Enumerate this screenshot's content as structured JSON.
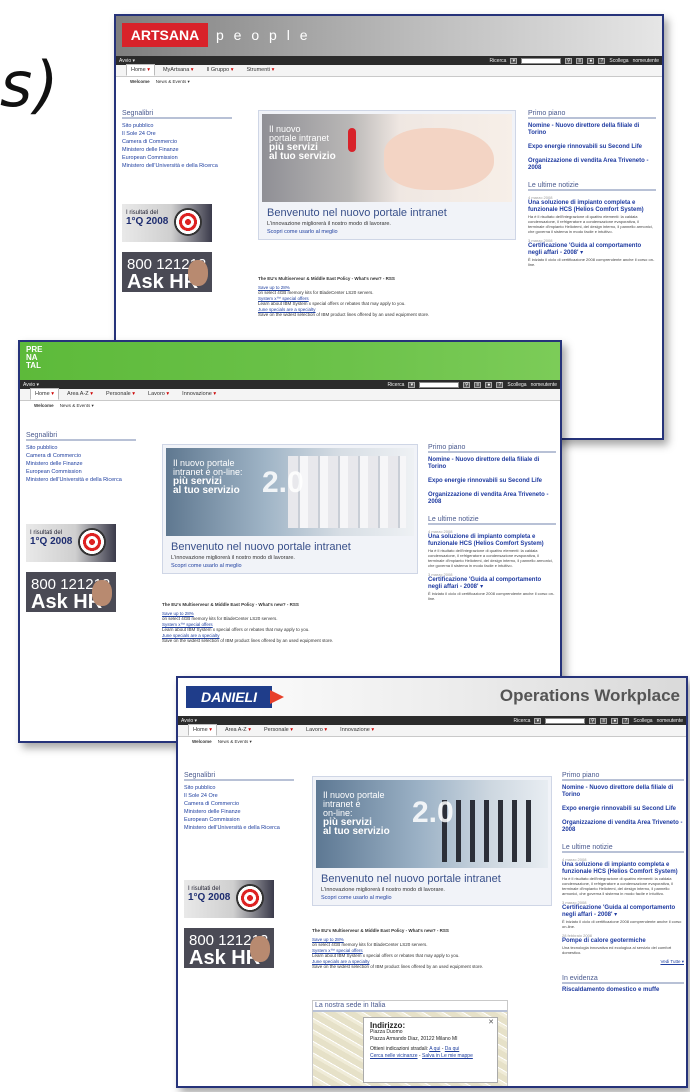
{
  "overlay_text": "s)",
  "common": {
    "nav_left": "Avvio ▾",
    "search_label": "Ricerca",
    "search_placeholder": "Cerca in Angolo",
    "help": "?",
    "logout": "Scollega",
    "user": "nomeutente",
    "subtabs": [
      "Welcome",
      "News & Events ▾"
    ],
    "left_title": "Segnalibri",
    "bookmarks": [
      "Sito pubblico",
      "Il Sole 24 Ore",
      "Camera di Commercio",
      "Ministero delle Finanze",
      "European Commission",
      "Ministero dell'Università e della Ricerca"
    ],
    "banner_results": "I risultati del",
    "banner_q": "1°Q 2008",
    "banner_phone": "800 121212",
    "banner_ask": "Ask HR",
    "hero_title": "Benvenuto nel nuovo portale intranet",
    "hero_sub": "L'innovazione migliorerà il nostro modo di lavorare.",
    "hero_link": "Scopri come usarlo al meglio",
    "feed_title": "The EU's Multiserveur & Middle East Policy - What's new? - RSS",
    "feed_lines": [
      "Save up to 28%",
      "on select 4GB memory kits for BladeCenter LS20 servers.",
      "System x™ special offers",
      "Learn about IBM System x special offers or rebates that may apply to you.",
      "June specials are a specialty",
      "Save on the widest selection of IBM product lines offered by an used equipment store."
    ],
    "right_title1": "Primo piano",
    "primo_piano": [
      "Nomine - Nuovo direttore della filiale di Torino",
      "Expo energie rinnovabili su Second Life",
      "Organizzazione di vendita Area Triveneto - 2008"
    ],
    "right_title2": "Le ultime notizie",
    "news": [
      {
        "date": "4 marzo 2008",
        "title": "Una soluzione di impianto completa e funzionale HCS (Helios Comfort System)",
        "body": "Ha è il risultato dell'integrazione di quattro elementi: la caldaia condensazione, il refrigeratore a condensazione evaporativa, il terminale d'impianto Heliotemi, del design interno, il pannello armonici, che governa il sistema in modo facile e intuitivo."
      },
      {
        "date": "3 marzo 2008",
        "title": "Certificazione 'Guida al comportamento negli affari - 2008' ▾",
        "body": "È iniziato il ciclo di certificazione 2008 comprendente anche il corso on-line."
      },
      {
        "date": "28 febbraio 2008",
        "title": "Pompe di calore geotermiche",
        "body": "Una tecnologia innovativa ed ecologica al servizio del comfort domestico."
      }
    ],
    "more": "Vedi Tutte ▾",
    "right_title3": "In evidenza",
    "evidence": "Riscaldamento domestico e muffe"
  },
  "screens": [
    {
      "brand": "ARTSANA",
      "brand_suffix": "p e o p l e",
      "tabs": [
        "Home",
        "MyArtsana",
        "Il Gruppo",
        "Strumenti"
      ],
      "hero_text": [
        "Il nuovo",
        "portale intranet"
      ],
      "hero_bold": [
        "più servizi",
        "al tuo servizio"
      ]
    },
    {
      "brand": "PRE NA TAL",
      "tabs": [
        "Home",
        "Area A-Z",
        "Personale",
        "Lavoro",
        "Innovazione"
      ],
      "hero_text": [
        "Il nuovo portale",
        "intranet è on-line:"
      ],
      "hero_bold": [
        "più servizi",
        "al tuo servizio"
      ],
      "badge": "2.0"
    },
    {
      "brand": "DANIELI",
      "brand_right": "Operations Workplace",
      "tabs": [
        "Home",
        "Area A-Z",
        "Personale",
        "Lavoro",
        "Innovazione"
      ],
      "hero_text": [
        "Il nuovo portale",
        "intranet è",
        "on-line:"
      ],
      "hero_bold": [
        "più servizi",
        "al tuo servizio"
      ],
      "badge": "2.0",
      "map": {
        "title": "La nostra sede in Italia",
        "popup_title": "Indirizzo:",
        "popup_lines": [
          "Piazza Duomo",
          "Piazza Armando Diaz, 20122 Milano MI"
        ],
        "popup_dir": "Ottieni indicazioni stradali:",
        "popup_links": [
          "A qui",
          "Da qui",
          "Cerca nelle vicinanze",
          "Salva in Le mie mappe"
        ]
      }
    }
  ],
  "colors": {
    "artsana_red": "#d8222a",
    "prenatal_green": "#6cc24a",
    "danieli_blue": "#1f3d8a",
    "link_blue": "#2040a0",
    "frame": "#26337a"
  }
}
